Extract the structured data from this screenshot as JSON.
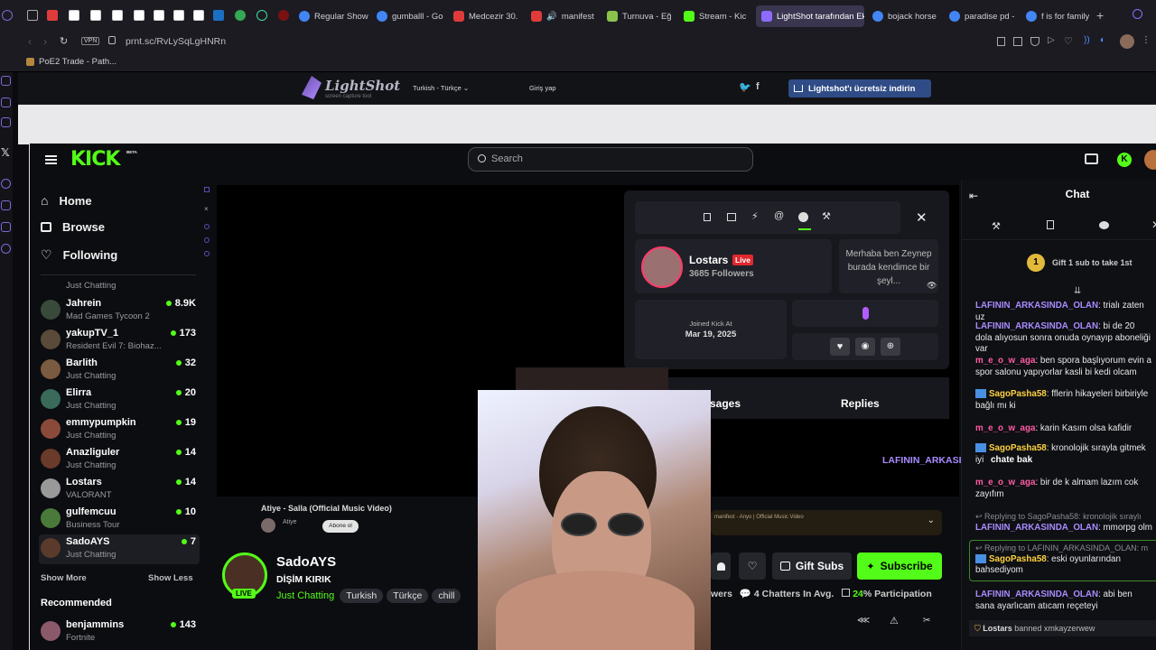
{
  "browser": {
    "tabs": [
      {
        "label": "Regular Show",
        "color": "#e03b3b"
      },
      {
        "label": "gumballl - Go",
        "color": "#4285f4"
      },
      {
        "label": "Medcezir 30.",
        "color": "#e03b3b"
      },
      {
        "label": "manifest",
        "color": "#e03b3b"
      },
      {
        "label": "Turnuva - Eğ",
        "color": "#8bc34a"
      },
      {
        "label": "Stream - Kic",
        "color": "#53fc18"
      },
      {
        "label": "LightShot tarafından Ek",
        "color": "#8e6bff"
      },
      {
        "label": "bojack horse",
        "color": "#4285f4"
      },
      {
        "label": "paradise pd -",
        "color": "#4285f4"
      },
      {
        "label": "f is for family",
        "color": "#4285f4"
      }
    ],
    "url": "prnt.sc/RvLySqLgHNRn",
    "vpn_badge": "VPN",
    "bookmark": "PoE2 Trade - Path..."
  },
  "lightshot": {
    "logo": "LightShot",
    "tagline": "screen capture tool",
    "language": "Turkish - Türkçe",
    "login": "Giriş yap",
    "download": "Lightshot'ı ücretsiz indirin"
  },
  "kick": {
    "logo": "KICK",
    "beta": "BETA",
    "search_placeholder": "Search",
    "nav": [
      {
        "label": "Home",
        "icon": "home-icon"
      },
      {
        "label": "Browse",
        "icon": "browse-icon"
      },
      {
        "label": "Following",
        "icon": "heart-icon"
      }
    ],
    "partial_first_game": "Just Chatting",
    "channels": [
      {
        "name": "Jahrein",
        "game": "Mad Games Tycoon 2",
        "viewers": "8.9K",
        "color": "#3a4a3a"
      },
      {
        "name": "yakupTV_1",
        "game": "Resident Evil 7: Biohaz...",
        "viewers": "173",
        "color": "#5a4a3a"
      },
      {
        "name": "Barlith",
        "game": "Just Chatting",
        "viewers": "32",
        "color": "#7a5a40"
      },
      {
        "name": "Elirra",
        "game": "Just Chatting",
        "viewers": "20",
        "color": "#3a6a5a"
      },
      {
        "name": "emmypumpkin",
        "game": "Just Chatting",
        "viewers": "19",
        "color": "#8a4a3a"
      },
      {
        "name": "Anazliguler",
        "game": "Just Chatting",
        "viewers": "14",
        "color": "#6a3a2a"
      },
      {
        "name": "Lostars",
        "game": "VALORANT",
        "viewers": "14",
        "color": "#999"
      },
      {
        "name": "gulfemcuu",
        "game": "Business Tour",
        "viewers": "10",
        "color": "#4a7a3a"
      },
      {
        "name": "SadoAYS",
        "game": "Just Chatting",
        "viewers": "7",
        "color": "#5a3a2a"
      }
    ],
    "show_more": "Show More",
    "show_less": "Show Less",
    "recommended": "Recommended",
    "recommended_channels": [
      {
        "name": "benjammins",
        "game": "Fortnite",
        "viewers": "143",
        "color": "#8a5a6a"
      }
    ]
  },
  "now_playing": {
    "title": "Atiye - Salla (Official Music Video)",
    "channel": "Atiye",
    "action": "Abone ol"
  },
  "streamer": {
    "name": "SadoAYS",
    "title": "DİŞİM KIRIK",
    "category": "Just Chatting",
    "tags": [
      "Turkish",
      "Türkçe",
      "chill"
    ],
    "live": "LIVE",
    "gift_subs": "Gift Subs",
    "subscribe": "Subscribe",
    "viewers_partial": "wers",
    "chatters": "4 Chatters In Avg.",
    "participation_value": "24",
    "participation_label": "% Participation",
    "music_bar": "manifest - Anyo | Official Music Video"
  },
  "popup": {
    "user": "Lostars",
    "live": "Live",
    "followers": "3685 Followers",
    "bio": "Merhaba ben Zeynep burada kendimce bir şeyl...",
    "joined_label": "Joined Kick At",
    "joined_date": "Mar 19, 2025",
    "tab_messages": "sages",
    "tab_replies": "Replies",
    "accent": "#53fc18"
  },
  "overlay_name": "LAFININ_ARKASIN...",
  "chat": {
    "title": "Chat",
    "gift_count": "1",
    "gift_text": "Gift 1 sub to take 1st",
    "messages": [
      {
        "user": "LAFININ_ARKASINDA_OLAN",
        "text": ": trialı zaten uz",
        "style": "u-purple"
      },
      {
        "user": "LAFININ_ARKASINDA_OLAN",
        "text": ": bi de 20 dola alıyosun sonra onuda oynayıp aboneliği var",
        "style": "u-purple"
      },
      {
        "user": "m_e_o_w_aga",
        "text": ": ben spora başlıyorum evin a spor salonu yapıyorlar kasli bi kedi olcam",
        "style": "u-pink"
      },
      {
        "user": "SagoPasha58",
        "text": ": fflerin hikayeleri birbiriyle bağlı mı ki",
        "style": "u-yellow"
      },
      {
        "user": "m_e_o_w_aga",
        "text": ": karin Kasım olsa kafidir",
        "style": "u-pink"
      },
      {
        "user": "SagoPasha58",
        "text": ": kronolojik sırayla gitmek iyi",
        "style": "u-yellow"
      },
      {
        "user": "m_e_o_w_aga",
        "text": ": bir de k almam lazım cok zayıfım",
        "style": "u-pink"
      },
      {
        "user": "LAFININ_ARKASINDA_OLAN",
        "text": ": mmorpg olm",
        "style": "u-purple",
        "reply": "Replying to SagoPasha58: kronolojik sıraylı"
      },
      {
        "user": "SagoPasha58",
        "text": ": eski oyunlarından bahsediyom",
        "style": "u-yellow",
        "reply": "Replying to LAFININ_ARKASINDA_OLAN: m"
      },
      {
        "user": "LAFININ_ARKASINDA_OLAN",
        "text": ": abi ben sana ayarlıcam atıcam reçeteyi",
        "style": "u-purple"
      }
    ],
    "inline_fragment": "chate bak",
    "ban_notice_user": "Lostars",
    "ban_notice_text": "banned xmkayzerwew"
  }
}
